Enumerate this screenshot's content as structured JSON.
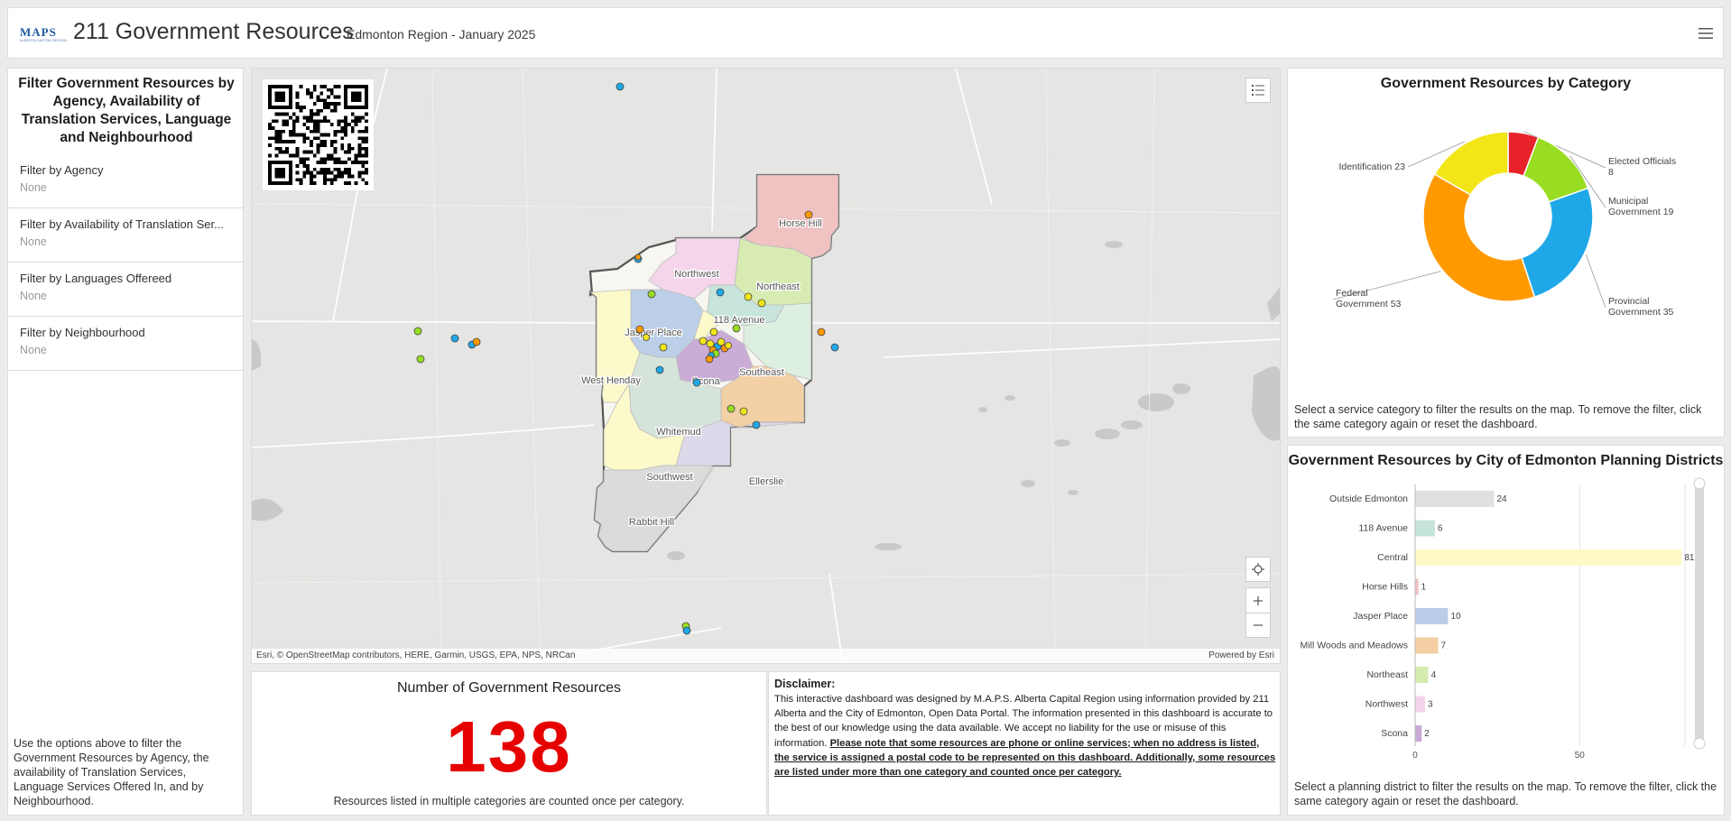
{
  "header": {
    "logo_text": "MAPS",
    "logo_subtext": "ALBERTA CAPITAL REGION",
    "title": "211 Government Resources",
    "subtitle": "Edmonton Region - January 2025",
    "menu_icon": "hamburger-menu-icon"
  },
  "filters": {
    "heading": "Filter Government Resources by Agency, Availability of Translation Services, Language and Neighbourhood",
    "items": [
      {
        "label": "Filter by Agency",
        "value": "None"
      },
      {
        "label": "Filter by Availability of Translation Ser...",
        "value": "None"
      },
      {
        "label": "Filter by Languages Offereed",
        "value": "None"
      },
      {
        "label": "Filter by Neighbourhood",
        "value": "None"
      }
    ],
    "help": "Use the options above to filter the Government Resources by Agency, the availability of Translation Services, Language Services Offered In, and by Neighbourhood."
  },
  "map": {
    "district_labels": [
      "Horse Hill",
      "Northwest",
      "Northeast",
      "118 Avenue",
      "Jasper Place",
      "Southeast",
      "West Henday",
      "Scona",
      "Whitemud",
      "Southwest",
      "Ellerslie",
      "Rabbit Hill"
    ],
    "attribution": "Esri, © OpenStreetMap contributors, HERE, Garmin, USGS, EPA, NPS, NRCan",
    "powered_by": "Powered by Esri",
    "legend_icon": "legend-list-icon",
    "locate_icon": "locate-icon",
    "zoom_in_icon": "zoom-in-icon",
    "zoom_out_icon": "zoom-out-icon",
    "colors": {
      "federal": "#ff9900",
      "provincial": "#1fa8e8",
      "municipal": "#99dd22",
      "identification": "#f2e618",
      "elected": "#e8222b"
    }
  },
  "count": {
    "title": "Number of Government Resources",
    "value": "138",
    "note": "Resources listed in multiple categories are counted once per category.",
    "color": "#e60000"
  },
  "disclaimer": {
    "title": "Disclaimer:",
    "body": "This interactive dashboard was designed by M.A.P.S. Alberta Capital Region using information provided by 211 Alberta and the City of Edmonton, Open Data Portal. The information presented in this dashboard is accurate to the best of our knowledge using the data available. We accept no liability for the use or misuse of this information.",
    "note": "Please note that some resources are phone or online services; when no address is listed, the service is assigned a postal code to be represented on this dashboard. Additionally, some resources are listed under more than one category and counted once per category."
  },
  "pie_panel": {
    "title": "Government Resources by Category",
    "help": "Select a service category to filter the results on the map. To remove the filter, click the same category again or reset the dashboard."
  },
  "bar_panel": {
    "title": "Government Resources by City of Edmonton Planning Districts",
    "help": "Select a planning district to filter the results on the map. To remove the filter, click the same category again or reset the dashboard."
  },
  "chart_data": [
    {
      "type": "pie",
      "title": "Government Resources by Category",
      "donut": true,
      "slices": [
        {
          "label": "Elected Officials",
          "value": 8,
          "color": "#e8222b"
        },
        {
          "label": "Municipal Government",
          "value": 19,
          "color": "#99dd22"
        },
        {
          "label": "Provincial Government",
          "value": 35,
          "color": "#1fa8e8"
        },
        {
          "label": "Federal Government",
          "value": 53,
          "color": "#ff9900"
        },
        {
          "label": "Identification",
          "value": 23,
          "color": "#f2e618"
        }
      ]
    },
    {
      "type": "bar",
      "orientation": "horizontal",
      "title": "Government Resources by City of Edmonton Planning Districts",
      "categories": [
        "Outside Edmonton",
        "118 Avenue",
        "Central",
        "Horse Hills",
        "Jasper Place",
        "Mill Woods and Meadows",
        "Northeast",
        "Northwest",
        "Scona"
      ],
      "values": [
        24,
        6,
        81,
        1,
        10,
        7,
        4,
        3,
        2
      ],
      "colors": [
        "#e0e0e0",
        "#c5e4dc",
        "#fdfac8",
        "#f0c0c0",
        "#b9cde8",
        "#f3cfa3",
        "#d6ebb0",
        "#f4d4ea",
        "#c8a9d6"
      ],
      "xlim": [
        0,
        82
      ],
      "xticks": [
        0,
        50
      ],
      "grid": true
    }
  ]
}
